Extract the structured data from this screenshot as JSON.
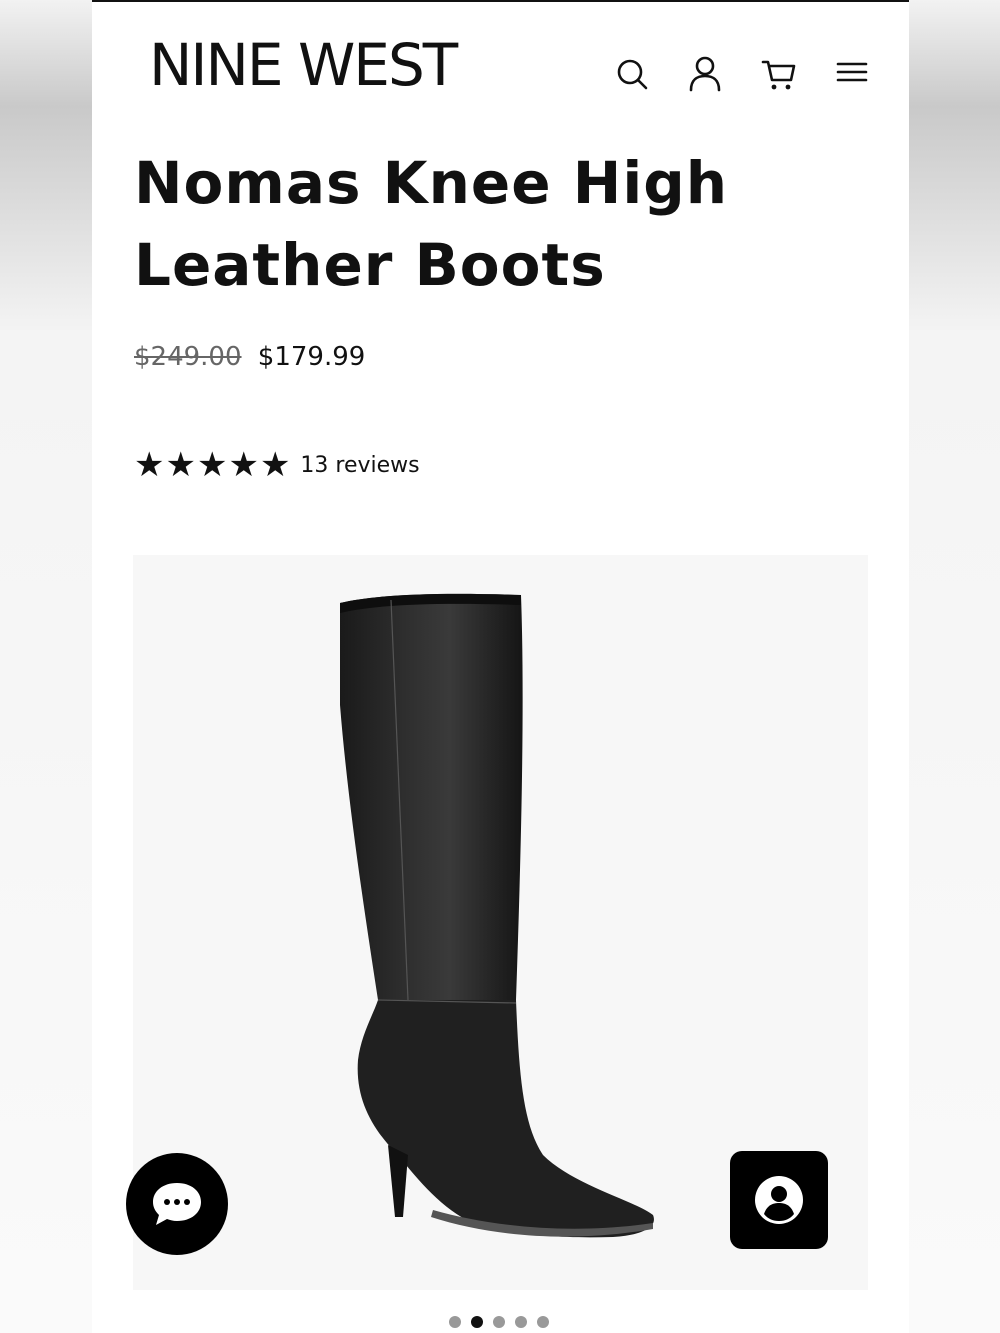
{
  "header": {
    "logo": "NINE WEST",
    "icons": [
      "search-icon",
      "account-icon",
      "cart-icon",
      "menu-icon"
    ]
  },
  "product": {
    "title": "Nomas Knee High Leather Boots",
    "original_price": "$249.00",
    "sale_price": "$179.99",
    "rating": 5,
    "rating_max": 5,
    "reviews_label": "13 reviews"
  },
  "gallery": {
    "image": "black-knee-high-leather-boot",
    "slide_count": 5,
    "active_slide": 2
  },
  "floating": {
    "chat": "chat-bubble-icon",
    "account": "user-circle-icon"
  },
  "colors": {
    "text": "#111111",
    "old_price": "#666666",
    "gallery_bg": "#f7f7f7",
    "button_bg": "#000000"
  }
}
